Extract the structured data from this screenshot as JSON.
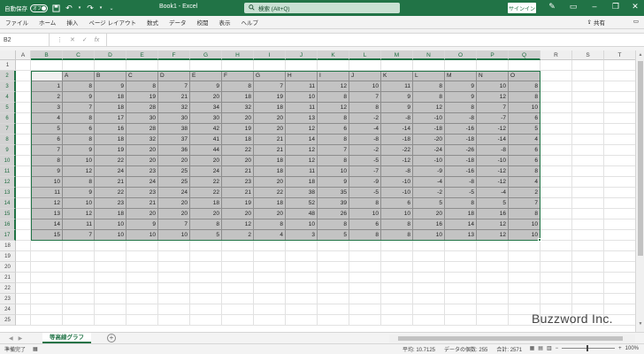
{
  "titlebar": {
    "autosave_label": "自動保存",
    "autosave_state": "オフ",
    "doc_title": "Book1 - Excel",
    "search_placeholder": "検索 (Alt+Q)",
    "signin_label": "サインイン"
  },
  "ribbon": {
    "tabs": [
      "ファイル",
      "ホーム",
      "挿入",
      "ページ レイアウト",
      "数式",
      "データ",
      "校閲",
      "表示",
      "ヘルプ"
    ],
    "share_label": "共有",
    "comment_icon": "comment-icon"
  },
  "formulabar": {
    "namebox": "B2",
    "fx": "fx",
    "value": ""
  },
  "grid": {
    "columns": [
      "A",
      "B",
      "C",
      "D",
      "E",
      "F",
      "G",
      "H",
      "I",
      "J",
      "K",
      "L",
      "M",
      "N",
      "O",
      "P",
      "Q",
      "R",
      "S",
      "T"
    ],
    "rows": [
      "1",
      "2",
      "3",
      "4",
      "5",
      "6",
      "7",
      "8",
      "9",
      "10",
      "11",
      "12",
      "13",
      "14",
      "15",
      "16",
      "17",
      "18",
      "19",
      "20",
      "21",
      "22",
      "23",
      "24",
      "25"
    ],
    "header_row": [
      "",
      "A",
      "B",
      "C",
      "D",
      "E",
      "F",
      "G",
      "H",
      "I",
      "J",
      "K",
      "L",
      "M",
      "N",
      "O"
    ],
    "data": [
      [
        "1",
        "8",
        "9",
        "8",
        "7",
        "9",
        "8",
        "7",
        "11",
        "12",
        "10",
        "11",
        "8",
        "9",
        "10",
        "8"
      ],
      [
        "2",
        "9",
        "18",
        "19",
        "21",
        "20",
        "18",
        "19",
        "10",
        "8",
        "7",
        "9",
        "8",
        "9",
        "12",
        "8"
      ],
      [
        "3",
        "7",
        "18",
        "28",
        "32",
        "34",
        "32",
        "18",
        "11",
        "12",
        "8",
        "9",
        "12",
        "8",
        "7",
        "10"
      ],
      [
        "4",
        "8",
        "17",
        "30",
        "30",
        "30",
        "20",
        "20",
        "13",
        "8",
        "-2",
        "-8",
        "-10",
        "-8",
        "-7",
        "6"
      ],
      [
        "5",
        "6",
        "16",
        "28",
        "38",
        "42",
        "19",
        "20",
        "12",
        "6",
        "-4",
        "-14",
        "-18",
        "-16",
        "-12",
        "5"
      ],
      [
        "6",
        "8",
        "18",
        "32",
        "37",
        "41",
        "18",
        "21",
        "14",
        "8",
        "-8",
        "-18",
        "-20",
        "-18",
        "-14",
        "4"
      ],
      [
        "7",
        "9",
        "19",
        "20",
        "36",
        "44",
        "22",
        "21",
        "12",
        "7",
        "-2",
        "-22",
        "-24",
        "-26",
        "-8",
        "6"
      ],
      [
        "8",
        "10",
        "22",
        "20",
        "20",
        "20",
        "20",
        "18",
        "12",
        "8",
        "-5",
        "-12",
        "-10",
        "-18",
        "-10",
        "6"
      ],
      [
        "9",
        "12",
        "24",
        "23",
        "25",
        "24",
        "21",
        "18",
        "11",
        "10",
        "-7",
        "-8",
        "-9",
        "-16",
        "-12",
        "8"
      ],
      [
        "10",
        "8",
        "21",
        "24",
        "25",
        "22",
        "23",
        "20",
        "18",
        "9",
        "-9",
        "-10",
        "-4",
        "-8",
        "-12",
        "4"
      ],
      [
        "11",
        "9",
        "22",
        "23",
        "24",
        "22",
        "21",
        "22",
        "38",
        "35",
        "-5",
        "-10",
        "-2",
        "-5",
        "-4",
        "2"
      ],
      [
        "12",
        "10",
        "23",
        "21",
        "20",
        "18",
        "19",
        "18",
        "52",
        "39",
        "8",
        "6",
        "5",
        "8",
        "5",
        "7"
      ],
      [
        "13",
        "12",
        "18",
        "20",
        "20",
        "20",
        "20",
        "20",
        "48",
        "26",
        "10",
        "10",
        "20",
        "18",
        "16",
        "8"
      ],
      [
        "14",
        "11",
        "10",
        "9",
        "7",
        "8",
        "12",
        "8",
        "10",
        "8",
        "6",
        "8",
        "16",
        "14",
        "12",
        "10"
      ],
      [
        "15",
        "7",
        "10",
        "10",
        "10",
        "5",
        "2",
        "4",
        "3",
        "5",
        "8",
        "8",
        "10",
        "13",
        "12",
        "10"
      ]
    ]
  },
  "sheets": {
    "active": "等高線グラフ",
    "add_label": "+"
  },
  "status": {
    "ready": "準備完了",
    "average": "平均: 10.7125",
    "count": "データの個数: 255",
    "sum": "合計: 2571",
    "zoom": "100%"
  },
  "watermark": "Buzzword Inc."
}
